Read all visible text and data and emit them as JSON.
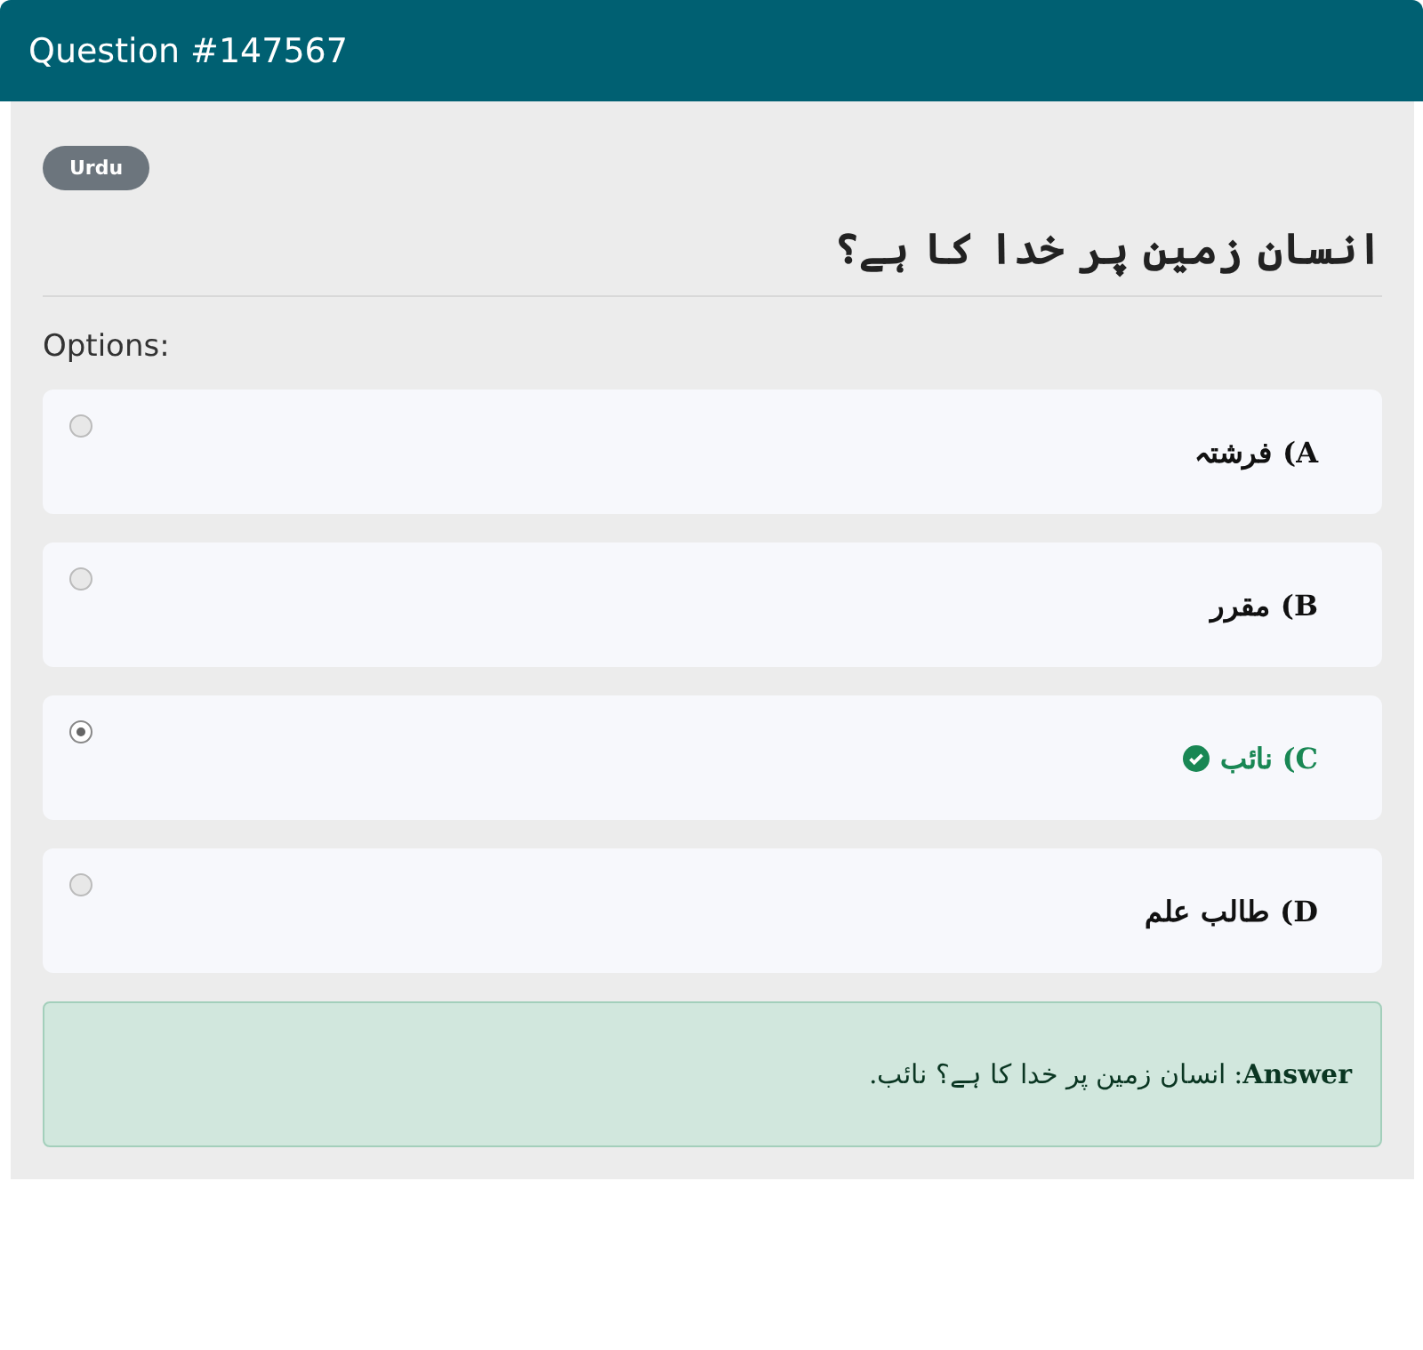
{
  "header": {
    "title": "Question #147567"
  },
  "badge": "Urdu",
  "question": "انسان زمین پر خدا کا ہے؟",
  "options_label": "Options:",
  "options": [
    {
      "label": "A) فرشتہ",
      "selected": false,
      "correct": false
    },
    {
      "label": "B) مقرر",
      "selected": false,
      "correct": false
    },
    {
      "label": "C) نائب",
      "selected": true,
      "correct": true
    },
    {
      "label": "D) طالب علم",
      "selected": false,
      "correct": false
    }
  ],
  "answer": "**Answer**: انسان زمین پر خدا کا ہے؟ نائب."
}
